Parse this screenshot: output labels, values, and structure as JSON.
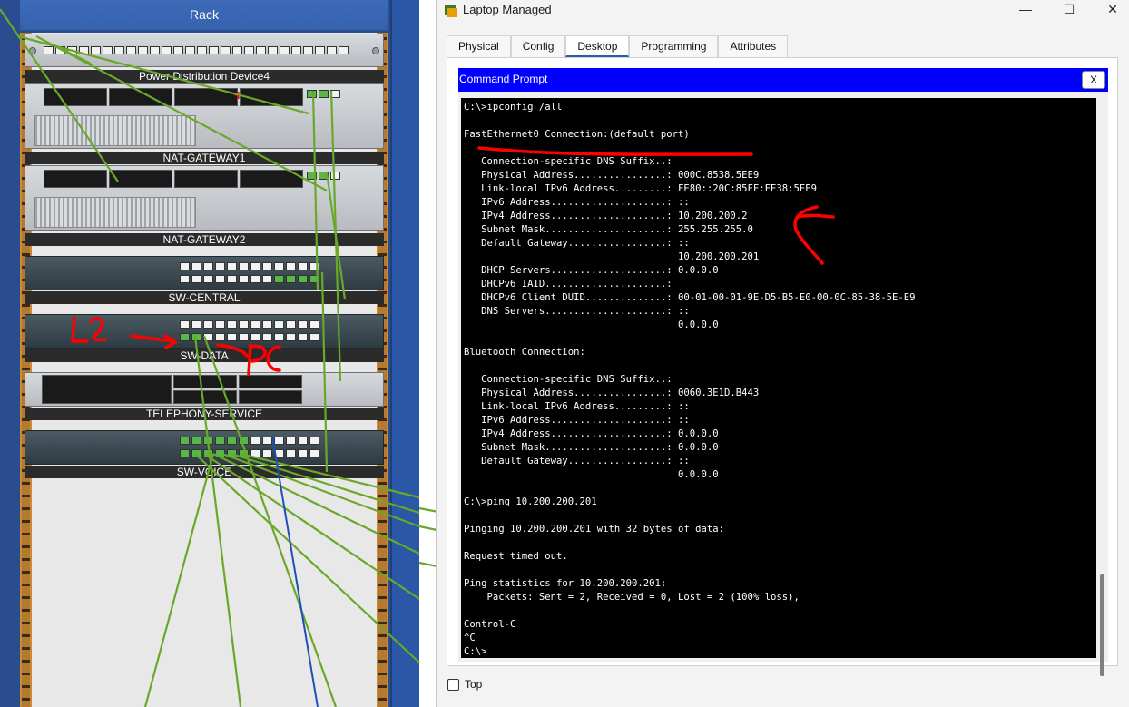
{
  "rack": {
    "title": "Rack",
    "devices": [
      {
        "label": "Power Distribution Device4"
      },
      {
        "label": "NAT-GATEWAY1"
      },
      {
        "label": "NAT-GATEWAY2"
      },
      {
        "label": "SW-CENTRAL"
      },
      {
        "label": "SW-DATA"
      },
      {
        "label": "TELEPHONY-SERVICE"
      },
      {
        "label": "SW-VOICE"
      }
    ],
    "annotation": {
      "l2": "L2",
      "pc": "PC"
    }
  },
  "window": {
    "title": "Laptop Managed",
    "tabs": [
      {
        "label": "Physical"
      },
      {
        "label": "Config"
      },
      {
        "label": "Desktop",
        "active": true
      },
      {
        "label": "Programming"
      },
      {
        "label": "Attributes"
      }
    ],
    "cmd": {
      "title": "Command Prompt",
      "close_label": "X",
      "lines": [
        "C:\\>ipconfig /all",
        "",
        "FastEthernet0 Connection:(default port)",
        "",
        "   Connection-specific DNS Suffix..:",
        "   Physical Address................: 000C.8538.5EE9",
        "   Link-local IPv6 Address.........: FE80::20C:85FF:FE38:5EE9",
        "   IPv6 Address....................: ::",
        "   IPv4 Address....................: 10.200.200.2",
        "   Subnet Mask.....................: 255.255.255.0",
        "   Default Gateway.................: ::",
        "                                     10.200.200.201",
        "   DHCP Servers....................: 0.0.0.0",
        "   DHCPv6 IAID.....................:",
        "   DHCPv6 Client DUID..............: 00-01-00-01-9E-D5-B5-E0-00-0C-85-38-5E-E9",
        "   DNS Servers.....................: ::",
        "                                     0.0.0.0",
        "",
        "Bluetooth Connection:",
        "",
        "   Connection-specific DNS Suffix..:",
        "   Physical Address................: 0060.3E1D.B443",
        "   Link-local IPv6 Address.........: ::",
        "   IPv6 Address....................: ::",
        "   IPv4 Address....................: 0.0.0.0",
        "   Subnet Mask.....................: 0.0.0.0",
        "   Default Gateway.................: ::",
        "                                     0.0.0.0",
        "",
        "C:\\>ping 10.200.200.201",
        "",
        "Pinging 10.200.200.201 with 32 bytes of data:",
        "",
        "Request timed out.",
        "",
        "Ping statistics for 10.200.200.201:",
        "    Packets: Sent = 2, Received = 0, Lost = 2 (100% loss),",
        "",
        "Control-C",
        "^C",
        "C:\\>"
      ]
    },
    "top_checkbox_label": "Top",
    "colors": {
      "cmd_titlebar": "#0000ff",
      "terminal_bg": "#000000",
      "terminal_fg": "#ffffff",
      "annotation": "#ff0000",
      "cable": "#6aa82a"
    }
  }
}
